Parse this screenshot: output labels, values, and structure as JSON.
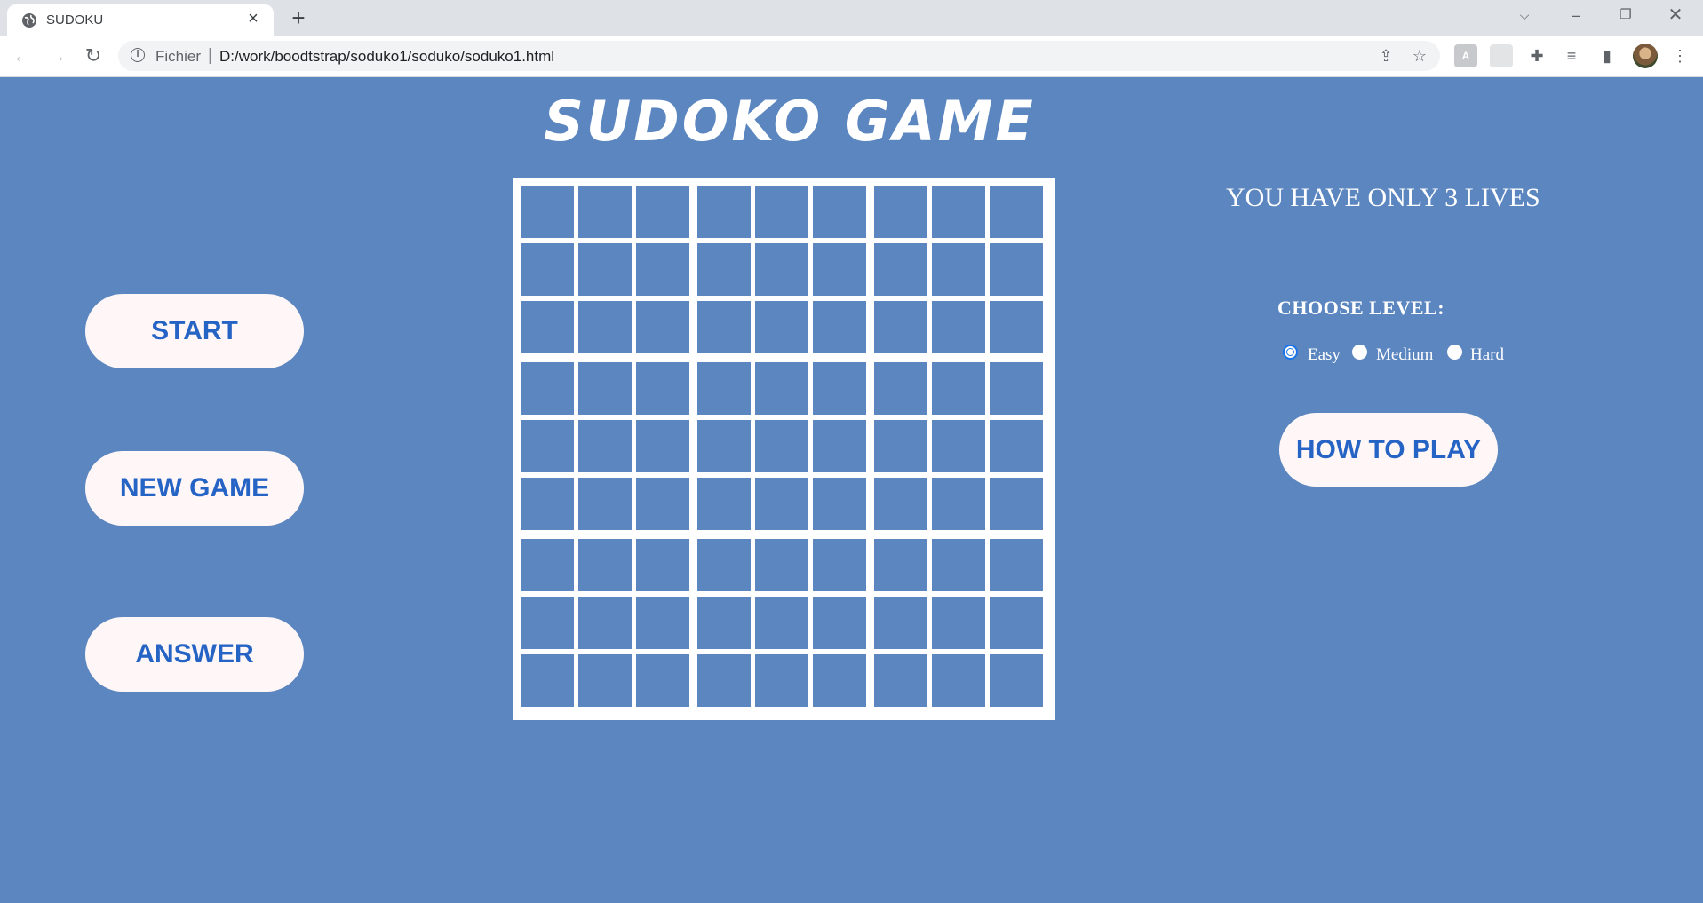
{
  "browser": {
    "tab_title": "SUDOKU",
    "url_scheme_label": "Fichier",
    "url_separator": "|",
    "url": "D:/work/boodtstrap/soduko1/soduko/soduko1.html"
  },
  "page": {
    "title": "SUDOKO GAME",
    "buttons": {
      "start": "START",
      "new_game": "NEW GAME",
      "answer": "ANSWER",
      "how_to_play": "HOW TO PLAY"
    },
    "lives_text": "YOU HAVE ONLY 3 LIVES",
    "level": {
      "label": "CHOOSE LEVEL:",
      "options": [
        {
          "label": "Easy",
          "checked": true
        },
        {
          "label": "Medium",
          "checked": false
        },
        {
          "label": "Hard",
          "checked": false
        }
      ]
    },
    "grid": {
      "rows": 9,
      "cols": 9
    }
  },
  "colors": {
    "background": "#5b86c0",
    "button_bg": "#fff7f7",
    "button_text": "#2563c4",
    "grid_lines": "#ffffff"
  }
}
